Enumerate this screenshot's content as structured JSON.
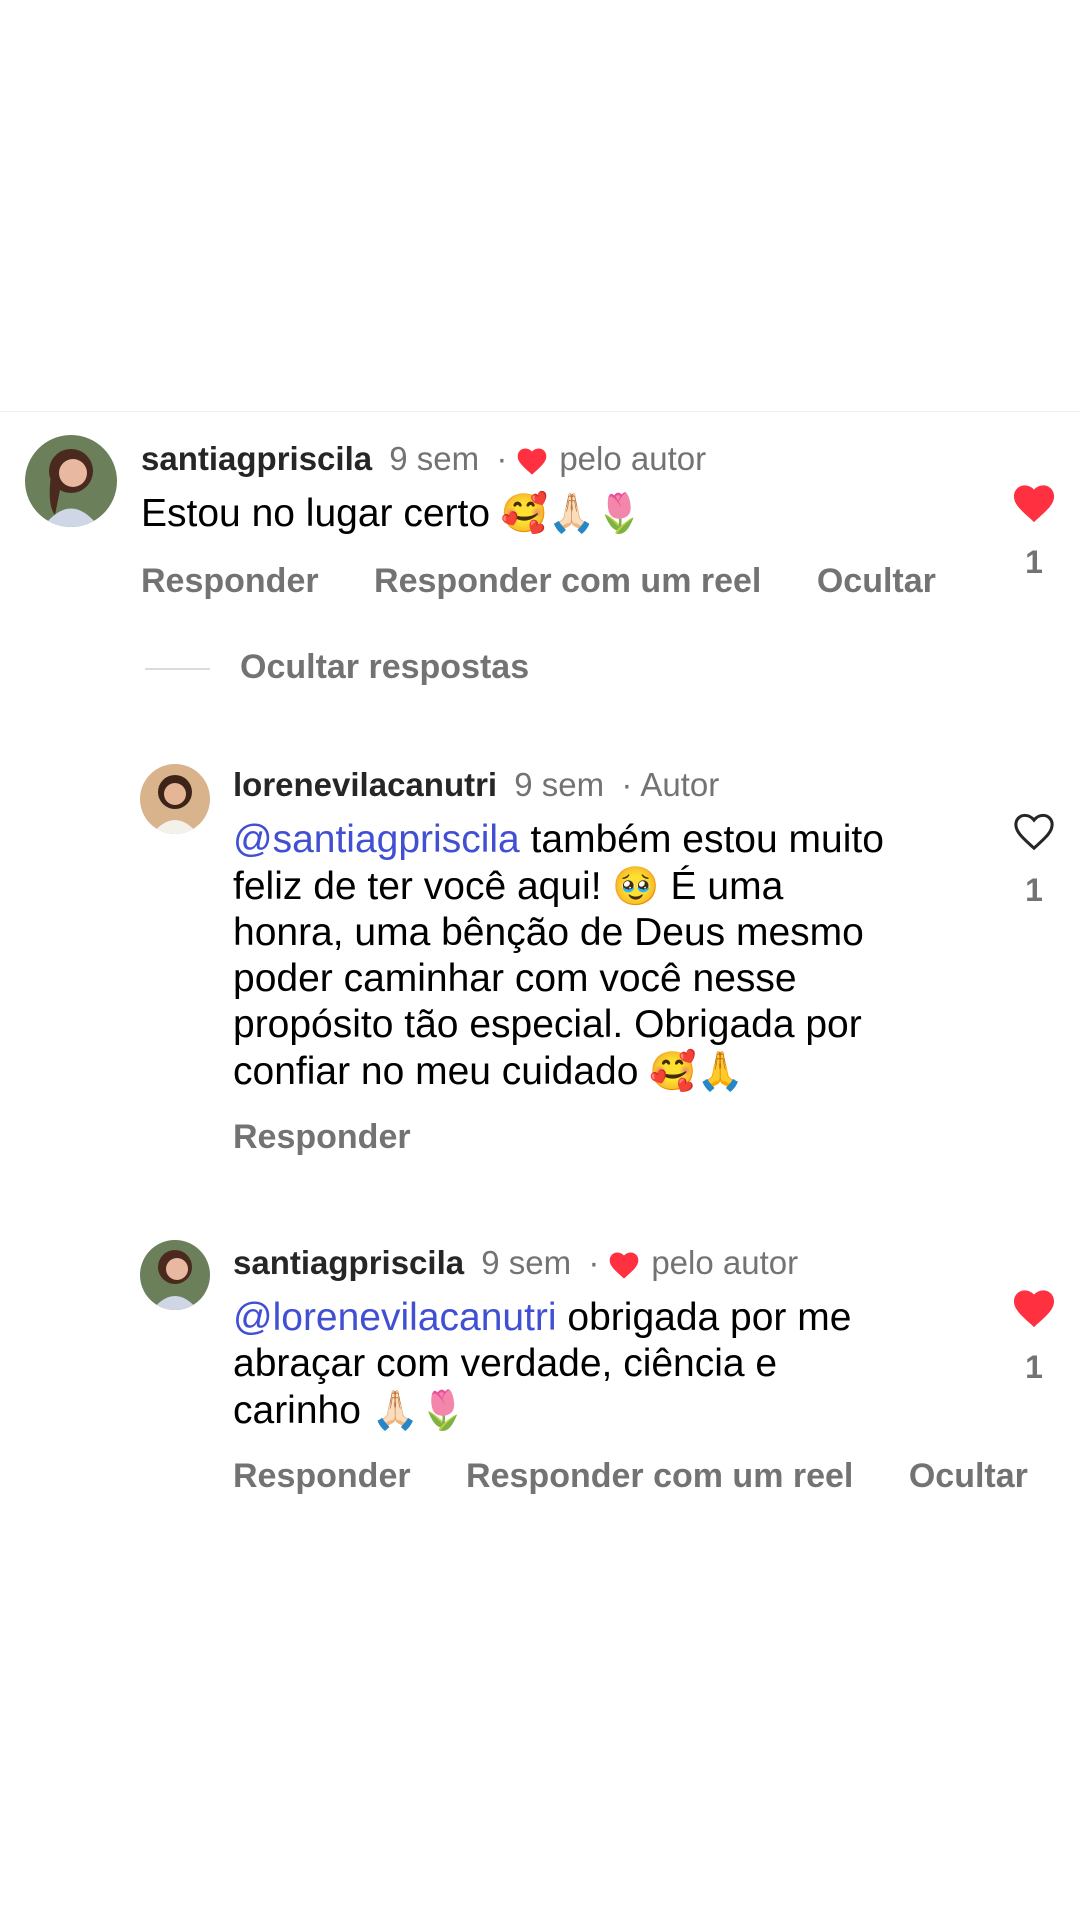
{
  "comments": [
    {
      "username": "santiagpriscila",
      "time": "9 sem",
      "separator": "·",
      "badge": "pelo autor",
      "text": "Estou no lugar certo",
      "emojis": "🥰🙏🏻🌷",
      "actions": [
        "Responder",
        "Responder com um reel",
        "Ocultar"
      ],
      "liked": true,
      "like_count": "1"
    }
  ],
  "hide_replies_label": "Ocultar respostas",
  "replies": [
    {
      "username": "lorenevilacanutri",
      "time": "9 sem",
      "separator": "·",
      "badge": "Autor",
      "mention": "@santiagpriscila",
      "text_line1": " também estou muito",
      "text_line2a": "feliz de ter você aqui! ",
      "emoji_mid": "🥹",
      "text_line2b": " É uma",
      "text_line3": "honra, uma bênção de Deus mesmo",
      "text_line4": "poder caminhar com você nesse",
      "text_line5": "propósito tão especial. Obrigada por",
      "text_line6": "confiar no meu cuidado ",
      "emojis_end": "🥰🙏",
      "actions": [
        "Responder"
      ],
      "liked": false,
      "like_count": "1"
    },
    {
      "username": "santiagpriscila",
      "time": "9 sem",
      "separator": "·",
      "badge": "pelo autor",
      "mention": "@lorenevilacanutri",
      "text_line1": " obrigada por me",
      "text_line2": "abraçar com verdade, ciência e",
      "text_line3": "carinho ",
      "emojis_end": "🙏🏻🌷",
      "actions": [
        "Responder",
        "Responder com um reel",
        "Ocultar"
      ],
      "liked": true,
      "like_count": "1"
    }
  ],
  "colors": {
    "like_red": "#ff3040",
    "mention_blue": "#4150d2",
    "meta_gray": "#737373"
  }
}
